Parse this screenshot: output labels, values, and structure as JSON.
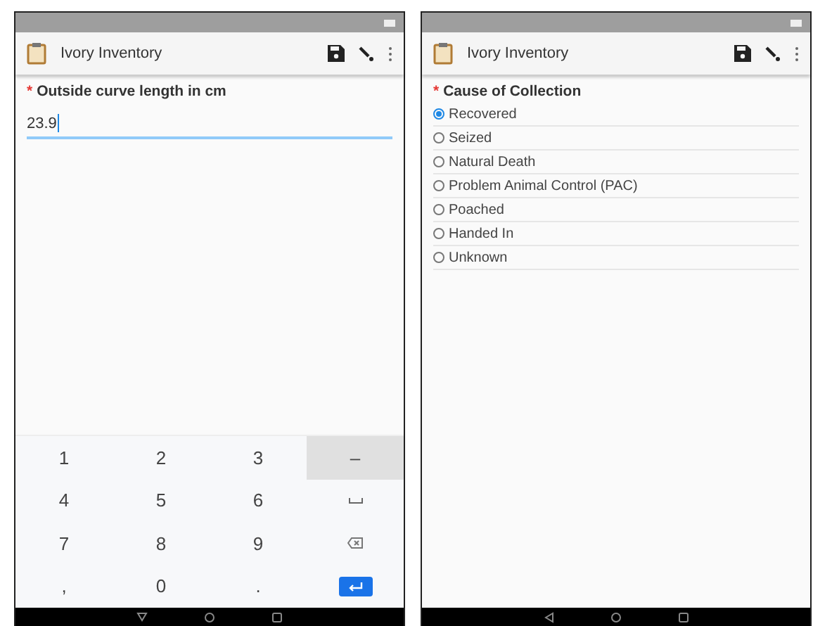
{
  "screens": [
    {
      "kind": "number_entry",
      "app_title": "Ivory Inventory",
      "question": {
        "required_mark": "*",
        "label": "Outside curve length in cm",
        "value": "23.9"
      },
      "keyboard": {
        "keys": [
          {
            "kind": "char",
            "label": "1",
            "pressed": false
          },
          {
            "kind": "char",
            "label": "2",
            "pressed": false
          },
          {
            "kind": "char",
            "label": "3",
            "pressed": false
          },
          {
            "kind": "char",
            "label": "–",
            "pressed": true
          },
          {
            "kind": "char",
            "label": "4",
            "pressed": false
          },
          {
            "kind": "char",
            "label": "5",
            "pressed": false
          },
          {
            "kind": "char",
            "label": "6",
            "pressed": false
          },
          {
            "kind": "space",
            "pressed": false
          },
          {
            "kind": "char",
            "label": "7",
            "pressed": false
          },
          {
            "kind": "char",
            "label": "8",
            "pressed": false
          },
          {
            "kind": "char",
            "label": "9",
            "pressed": false
          },
          {
            "kind": "backspace",
            "pressed": false
          },
          {
            "kind": "char",
            "label": ",",
            "pressed": false
          },
          {
            "kind": "char",
            "label": "0",
            "pressed": false
          },
          {
            "kind": "char",
            "label": ".",
            "pressed": false
          },
          {
            "kind": "enter",
            "pressed": false
          }
        ]
      }
    },
    {
      "kind": "single_choice",
      "app_title": "Ivory Inventory",
      "question": {
        "required_mark": "*",
        "label": "Cause of Collection",
        "options": [
          {
            "label": "Recovered",
            "selected": true
          },
          {
            "label": "Seized",
            "selected": false
          },
          {
            "label": "Natural Death",
            "selected": false
          },
          {
            "label": "Problem Animal Control (PAC)",
            "selected": false
          },
          {
            "label": "Poached",
            "selected": false
          },
          {
            "label": "Handed In",
            "selected": false
          },
          {
            "label": "Unknown",
            "selected": false
          }
        ]
      }
    }
  ]
}
